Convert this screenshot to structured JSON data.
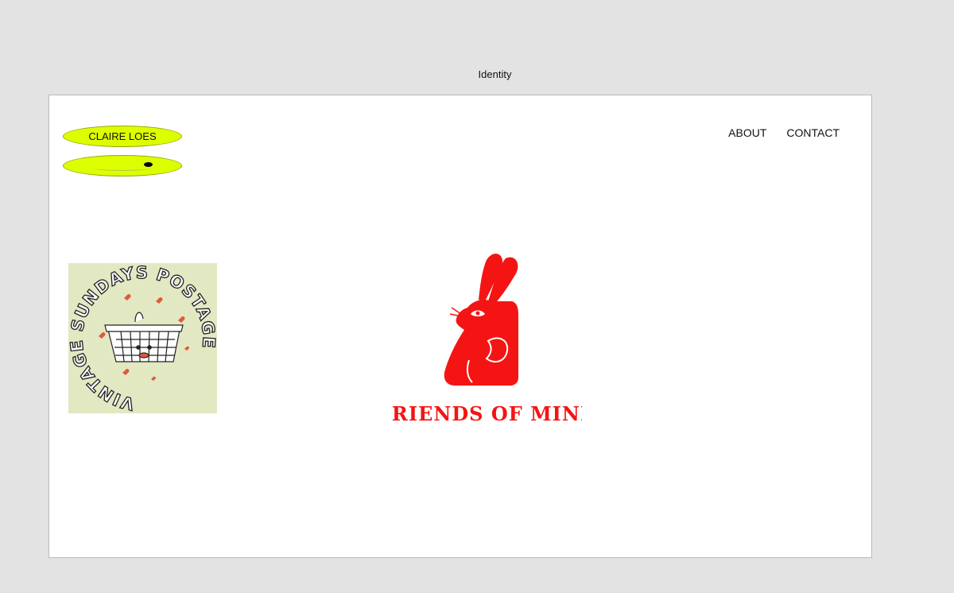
{
  "window": {
    "title": "Identity"
  },
  "header": {
    "logo_text": "CLAIRE LOES",
    "nav": [
      {
        "label": "ABOUT"
      },
      {
        "label": "CONTACT"
      }
    ]
  },
  "gallery": {
    "vintage_sundays": {
      "ring_text": "VINTAGE SUNDAYS POSTAGE",
      "colors": {
        "background": "#e2e8c2",
        "hearts": "#e05a3a",
        "ink": "#222222"
      }
    },
    "friends_of_mine": {
      "wordmark": "FRIENDS OF MINE",
      "colors": {
        "brand": "#f51414"
      }
    }
  },
  "colors": {
    "accent": "#dcff00",
    "page_bg": "#e3e3e3",
    "canvas_bg": "#ffffff"
  }
}
